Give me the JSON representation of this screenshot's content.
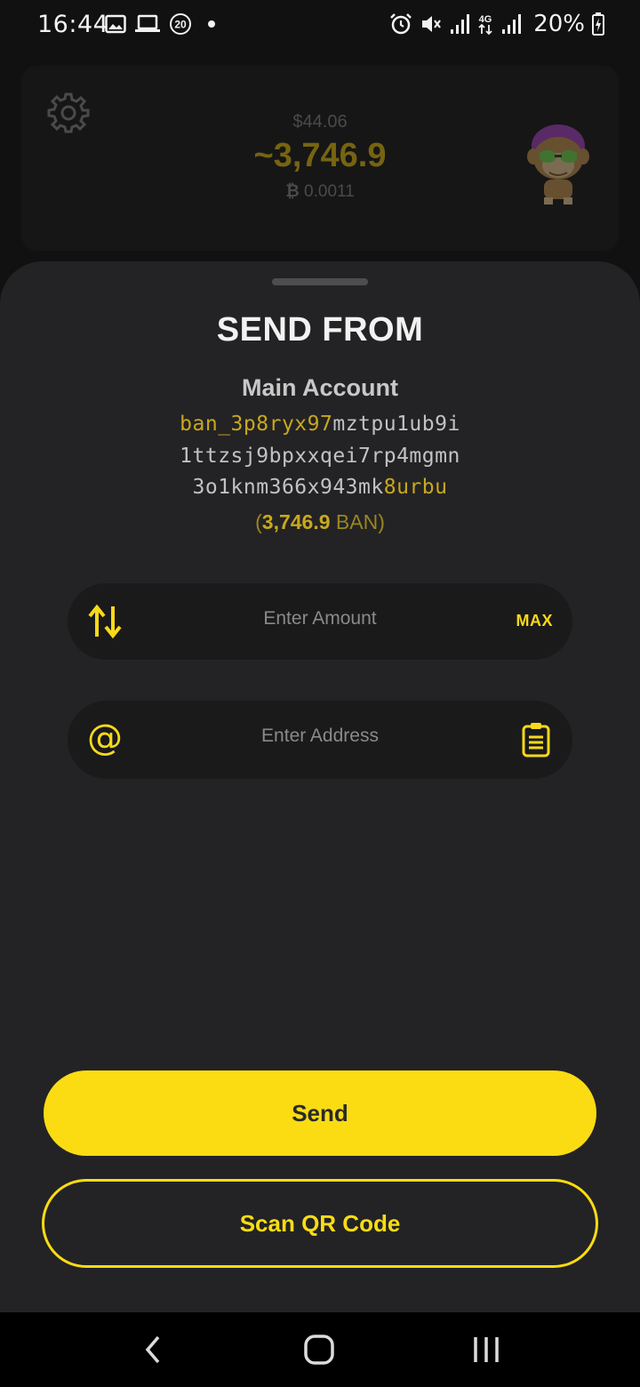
{
  "status_bar": {
    "time": "16:44",
    "notification_badge": "20",
    "network": "4G",
    "battery": "20%",
    "icons": [
      "image-icon",
      "laptop-icon",
      "badge-20-icon",
      "dot-icon",
      "alarm-icon",
      "mute-icon",
      "signal-icon",
      "network-4g-icon",
      "signal-icon",
      "battery-charging-icon"
    ]
  },
  "header": {
    "fiat_balance": "$44.06",
    "main_balance": "~3,746.9",
    "btc_balance": "0.0011",
    "btc_symbol": "₿",
    "settings_icon": "gear-icon",
    "avatar_icon": "monkey-avatar"
  },
  "sheet": {
    "title": "SEND FROM",
    "account_name": "Main Account",
    "address": {
      "line1_highlight": "ban_3p8ryx97",
      "line1_rest": "mztpu1ub9i",
      "line2": "1ttzsj9bpxxqei7rp4mgmn",
      "line3_rest": "3o1knm366x943mk",
      "line3_highlight": "8urbu"
    },
    "balance": {
      "open": "(",
      "amount": "3,746.9",
      "unit": " BAN",
      "close": ")"
    },
    "amount_field": {
      "placeholder": "Enter Amount",
      "value": "",
      "max_label": "MAX",
      "icon": "swap-arrows-icon"
    },
    "address_field": {
      "placeholder": "Enter Address",
      "value": "",
      "left_icon": "at-icon",
      "at_glyph": "@",
      "right_icon": "clipboard-icon"
    },
    "send_label": "Send",
    "scan_label": "Scan QR Code"
  },
  "colors": {
    "accent": "#fbdc13",
    "sheet_bg": "#232325",
    "field_bg": "#1a1a1b"
  },
  "nav_bar": {
    "icons": [
      "back-icon",
      "home-icon",
      "recents-icon"
    ]
  }
}
